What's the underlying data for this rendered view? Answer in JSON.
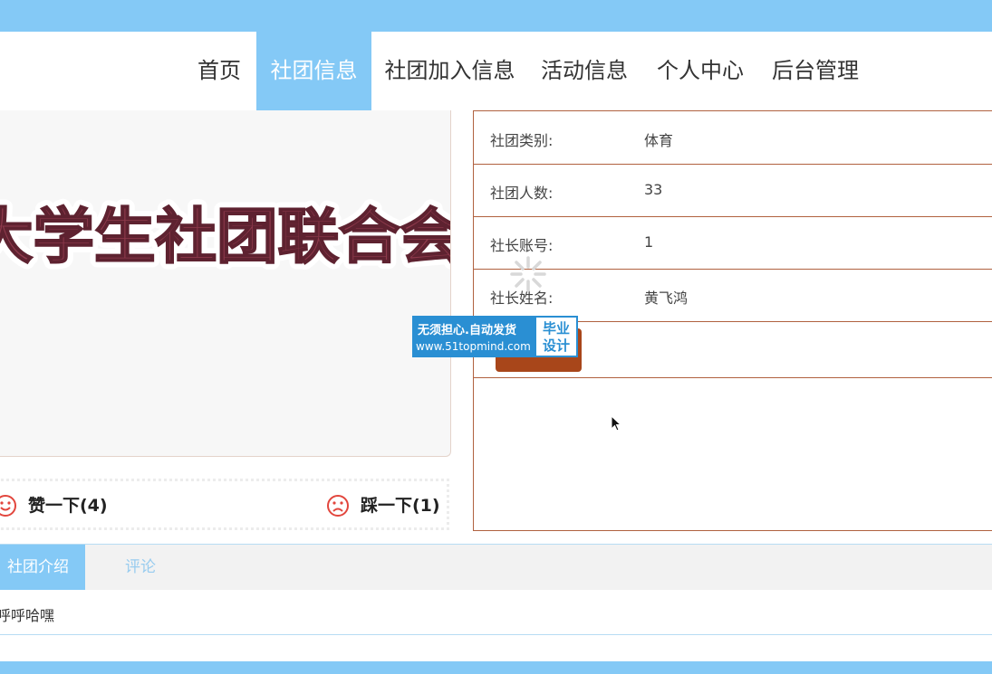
{
  "nav": {
    "items": [
      {
        "label": "首页",
        "active": false
      },
      {
        "label": "社团信息",
        "active": true
      },
      {
        "label": "社团加入信息",
        "active": false
      },
      {
        "label": "活动信息",
        "active": false
      },
      {
        "label": "个人中心",
        "active": false
      },
      {
        "label": "后台管理",
        "active": false
      }
    ]
  },
  "banner": {
    "text": "大学生社团联合会"
  },
  "votes": {
    "like_label": "赞一下(4)",
    "dislike_label": "踩一下(1)"
  },
  "info": {
    "rows": [
      {
        "label": "社团类别:",
        "value": "体育"
      },
      {
        "label": "社团人数:",
        "value": "33"
      },
      {
        "label": "社长账号:",
        "value": "1"
      },
      {
        "label": "社长姓名:",
        "value": "黄飞鸿"
      }
    ]
  },
  "watermark": {
    "line1": "无须担心.自动发货",
    "line2": "www.51topmind.com",
    "badge_line1": "毕业",
    "badge_line2": "设计"
  },
  "tabs": {
    "items": [
      {
        "label": "社团介绍",
        "active": true
      },
      {
        "label": "评论",
        "active": false
      }
    ],
    "content": "呼呼哈嘿"
  },
  "colors": {
    "accent": "#84c9f6",
    "border": "#b0613f",
    "button": "#a8461a",
    "banner_text": "#8e3a4c",
    "vote_icon": "#e2463d"
  }
}
